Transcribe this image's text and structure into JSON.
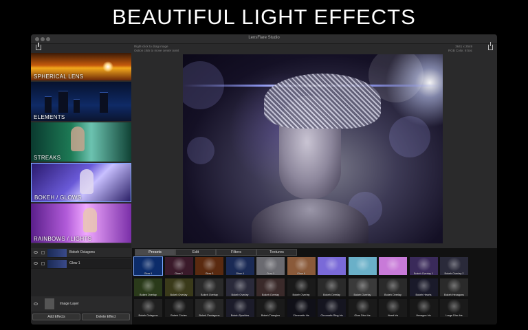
{
  "headline": "BEAUTIFUL LIGHT EFFECTS",
  "window": {
    "title": "LensFlare Studio",
    "hint_line1": "Right-click to drag image",
    "hint_line2": "Option click to move center point",
    "image_dims": "3641 x 2549",
    "image_format": "RGB Color, 8 bpc",
    "import_icon": "import-icon",
    "share_icon": "share-icon"
  },
  "categories": [
    {
      "label": "SPHERICAL LENS"
    },
    {
      "label": "ELEMENTS"
    },
    {
      "label": "STREAKS"
    },
    {
      "label": "BOKEH / GLOWS",
      "selected": true
    },
    {
      "label": "RAINBOWS / LIGHTS"
    }
  ],
  "layers": {
    "rows": [
      {
        "name": "Bokeh Octagons"
      },
      {
        "name": "Glow 1"
      }
    ],
    "image_layer": "Image Layer",
    "add_button": "Add Effects",
    "delete_button": "Delete Effect"
  },
  "browser": {
    "tabs": [
      "Presets",
      "Edit",
      "Filters",
      "Textures"
    ],
    "active_tab": "Presets",
    "presets": [
      [
        "Glow 1",
        "Glow 2",
        "Glow 3",
        "Glow 4",
        "Glow 5",
        "Glow 6",
        "",
        "",
        "",
        "Bokeh Overlay 1",
        "Bokeh Overlay 2"
      ],
      [
        "Bokeh Overlay",
        "Bokeh Overlay",
        "Bokeh Overlay",
        "Bokeh Overlay",
        "Bokeh Overlay",
        "Bokeh Overlay",
        "Bokeh Overlay",
        "Bokeh Overlay",
        "Bokeh Overlay",
        "Bokeh Hearts",
        "Bokeh Hexagons"
      ],
      [
        "Bokeh Octagons",
        "Bokeh Circles",
        "Bokeh Pentagons",
        "Bokeh Sparkles",
        "Bokeh Triangles",
        "Chromatic Iris",
        "Chromatic Ring Iris",
        "Glow Disc Iris",
        "Heart Iris",
        "Hexagon Iris",
        "Large Disc Iris"
      ]
    ]
  }
}
